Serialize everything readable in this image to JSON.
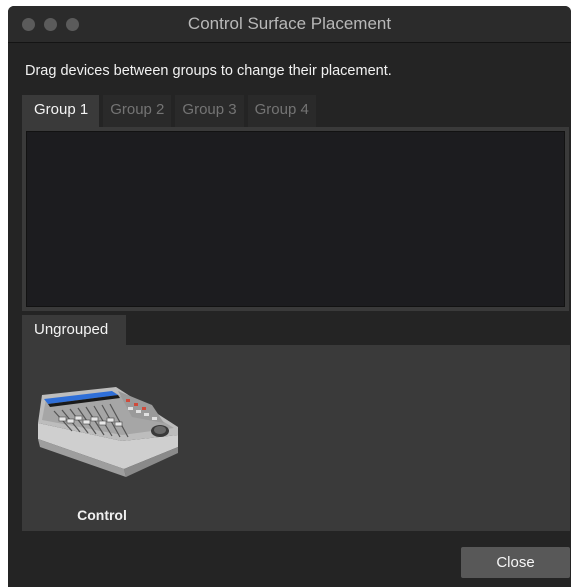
{
  "window": {
    "title": "Control Surface Placement",
    "traffic_lights": [
      "close",
      "minimize",
      "zoom"
    ]
  },
  "instructions": "Drag devices between groups to change their placement.",
  "tabs": [
    {
      "label": "Group 1",
      "active": true
    },
    {
      "label": "Group 2",
      "active": false
    },
    {
      "label": "Group 3",
      "active": false
    },
    {
      "label": "Group 4",
      "active": false
    }
  ],
  "ungrouped": {
    "tab_label": "Ungrouped",
    "devices": [
      {
        "label": "Control",
        "icon": "control-surface-device-icon"
      }
    ]
  },
  "buttons": {
    "close_label": "Close"
  },
  "colors": {
    "window_bg": "#242424",
    "panel_bg": "#3a3a3a",
    "inactive_tab_text": "#747474",
    "button_bg": "#585858"
  }
}
